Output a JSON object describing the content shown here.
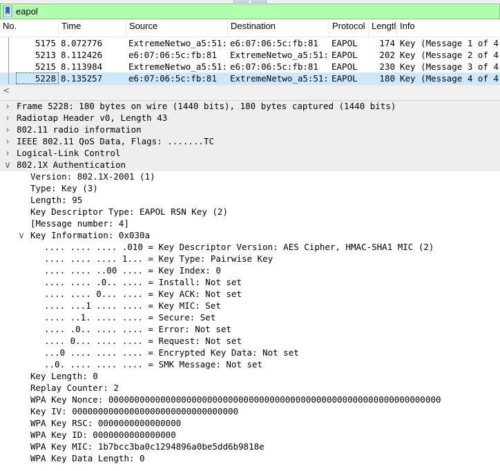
{
  "filter": {
    "value": "eapol",
    "icon": "bookmark-icon"
  },
  "columns": [
    "No.",
    "Time",
    "Source",
    "Destination",
    "Protocol",
    "Lengtl",
    "Info"
  ],
  "packets": [
    {
      "no": "5175",
      "time": "8.072776",
      "source": "ExtremeNetwo_a5:51:…",
      "destination": "e6:07:06:5c:fb:81",
      "protocol": "EAPOL",
      "length": "174",
      "info": "Key (Message 1 of 4)"
    },
    {
      "no": "5213",
      "time": "8.112426",
      "source": "e6:07:06:5c:fb:81",
      "destination": "ExtremeNetwo_a5:51:…",
      "protocol": "EAPOL",
      "length": "202",
      "info": "Key (Message 2 of 4)"
    },
    {
      "no": "5215",
      "time": "8.113984",
      "source": "ExtremeNetwo_a5:51:…",
      "destination": "e6:07:06:5c:fb:81",
      "protocol": "EAPOL",
      "length": "230",
      "info": "Key (Message 3 of 4)"
    },
    {
      "no": "5228",
      "time": "8.135257",
      "source": "e6:07:06:5c:fb:81",
      "destination": "ExtremeNetwo_a5:51:…",
      "protocol": "EAPOL",
      "length": "180",
      "info": "Key (Message 4 of 4)"
    }
  ],
  "selected_packet": "5228",
  "scroll_left_arrow": "<",
  "tree": [
    {
      "text": "Frame 5228: 180 bytes on wire (1440 bits), 180 bytes captured (1440 bits)",
      "expander": ">",
      "band": true
    },
    {
      "text": "Radiotap Header v0, Length 43",
      "expander": ">",
      "band": true
    },
    {
      "text": "802.11 radio information",
      "expander": ">",
      "band": true
    },
    {
      "text": "IEEE 802.11 QoS Data, Flags: .......TC",
      "expander": ">",
      "band": true
    },
    {
      "text": "Logical-Link Control",
      "expander": ">",
      "band": true
    },
    {
      "text": "802.1X Authentication",
      "expander": "v",
      "band": true
    },
    {
      "text": "Version: 802.1X-2001 (1)",
      "indent": 1
    },
    {
      "text": "Type: Key (3)",
      "indent": 1
    },
    {
      "text": "Length: 95",
      "indent": 1
    },
    {
      "text": "Key Descriptor Type: EAPOL RSN Key (2)",
      "indent": 1
    },
    {
      "text": "[Message number: 4]",
      "indent": 1
    },
    {
      "text": "Key Information: 0x030a",
      "indent": 1,
      "expander": "v"
    },
    {
      "text": ".... .... .... .010 = Key Descriptor Version: AES Cipher, HMAC-SHA1 MIC (2)",
      "indent": 2
    },
    {
      "text": ".... .... .... 1... = Key Type: Pairwise Key",
      "indent": 2
    },
    {
      "text": ".... .... ..00 .... = Key Index: 0",
      "indent": 2
    },
    {
      "text": ".... .... .0.. .... = Install: Not set",
      "indent": 2
    },
    {
      "text": ".... .... 0... .... = Key ACK: Not set",
      "indent": 2
    },
    {
      "text": ".... ...1 .... .... = Key MIC: Set",
      "indent": 2
    },
    {
      "text": ".... ..1. .... .... = Secure: Set",
      "indent": 2
    },
    {
      "text": ".... .0.. .... .... = Error: Not set",
      "indent": 2
    },
    {
      "text": ".... 0... .... .... = Request: Not set",
      "indent": 2
    },
    {
      "text": "...0 .... .... .... = Encrypted Key Data: Not set",
      "indent": 2
    },
    {
      "text": "..0. .... .... .... = SMK Message: Not set",
      "indent": 2
    },
    {
      "text": "Key Length: 0",
      "indent": 1
    },
    {
      "text": "Replay Counter: 2",
      "indent": 1
    },
    {
      "text": "WPA Key Nonce: 0000000000000000000000000000000000000000000000000000000000000000",
      "indent": 1
    },
    {
      "text": "Key IV: 00000000000000000000000000000000",
      "indent": 1
    },
    {
      "text": "WPA Key RSC: 0000000000000000",
      "indent": 1
    },
    {
      "text": "WPA Key ID: 0000000000000000",
      "indent": 1
    },
    {
      "text": "WPA Key MIC: 1b7bcc3ba0c1294896a0be5dd6b9818e",
      "indent": 1
    },
    {
      "text": "WPA Key Data Length: 0",
      "indent": 1
    }
  ]
}
